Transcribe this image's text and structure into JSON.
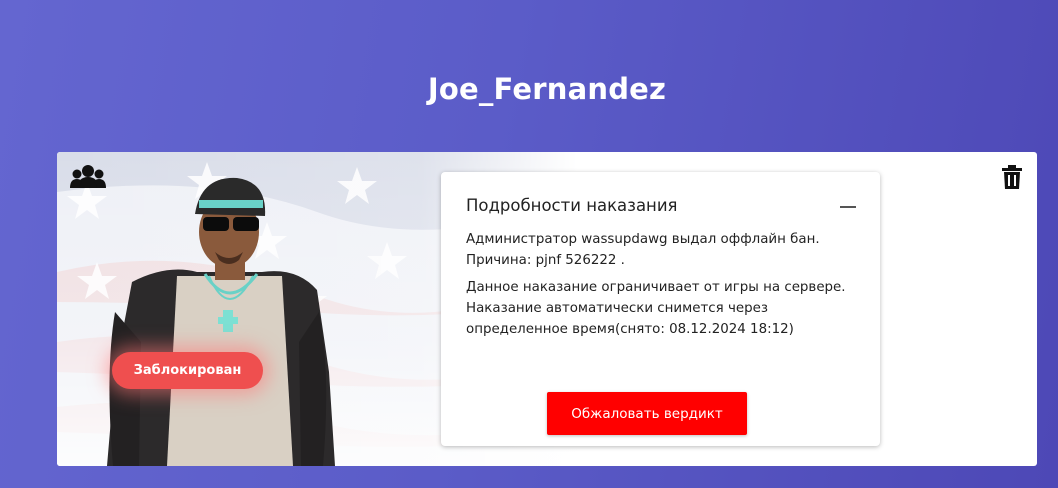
{
  "profile": {
    "name": "Joe_Fernandez"
  },
  "card": {
    "icons": {
      "group": "users-group-icon",
      "delete": "trash-icon"
    },
    "status_badge": "Заблокирован",
    "details": {
      "title": "Подробности наказания",
      "line1": "Администратор wassupdawg выдал оффлайн бан.",
      "line2": "Причина: pjnf 526222 .",
      "paragraph2": "Данное наказание ограничивает от игры на сервере. Наказание автоматически снимется через определенное время(снято: 08.12.2024 18:12)",
      "appeal_button": "Обжаловать вердикт"
    }
  },
  "colors": {
    "background_start": "#6466d0",
    "background_end": "#4d48b6",
    "badge": "#ef4f4f",
    "appeal_button": "#ff0000"
  }
}
